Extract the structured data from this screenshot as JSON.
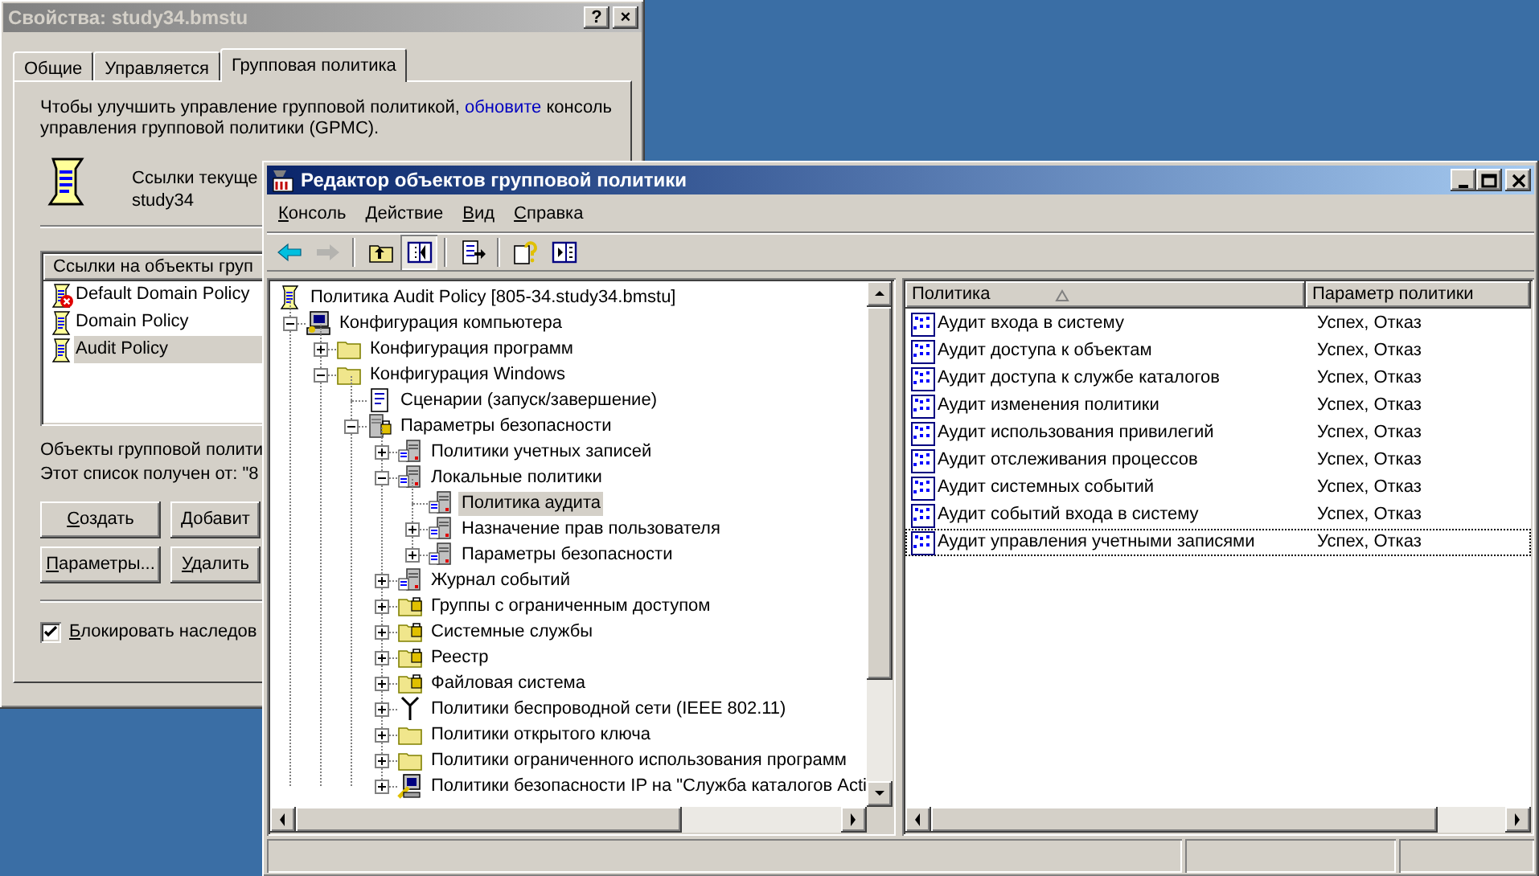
{
  "properties_window": {
    "title": "Свойства: study34.bmstu",
    "title_buttons": [
      "?",
      "×"
    ],
    "tabs": [
      {
        "label": "Общие",
        "selected": false
      },
      {
        "label": "Управляется",
        "selected": false
      },
      {
        "label": "Групповая политика",
        "selected": true
      }
    ],
    "intro": {
      "before": "Чтобы улучшить управление групповой политикой, ",
      "link": "обновите",
      "after": " консоль управления групповой политики (GPMC)."
    },
    "links_label": "Ссылки текуще",
    "domain": "study34",
    "list": {
      "header": "Ссылки на объекты груп",
      "items": [
        {
          "label": "Default Domain Policy",
          "kind": "disabled",
          "selected": false
        },
        {
          "label": "Domain Policy",
          "kind": "enabled",
          "selected": false
        },
        {
          "label": "Audit Policy",
          "kind": "enabled",
          "selected": true
        }
      ]
    },
    "objects_note": "Объекты групповой полити",
    "source_note": "Этот список получен от: \"8",
    "buttons": [
      "Создать",
      "Добавит",
      "Параметры...",
      "Удалить"
    ],
    "block_inheritance": {
      "label": "Блокировать наследов",
      "checked": true
    }
  },
  "editor_window": {
    "title": "Редактор объектов групповой политики",
    "menu": [
      "Консоль",
      "Действие",
      "Вид",
      "Справка"
    ],
    "toolbar": [
      {
        "kind": "back",
        "disabled": false,
        "pressed": false
      },
      {
        "kind": "forward",
        "disabled": true,
        "pressed": false
      },
      {
        "kind": "separator"
      },
      {
        "kind": "up",
        "disabled": false,
        "pressed": false
      },
      {
        "kind": "tree",
        "disabled": false,
        "pressed": true
      },
      {
        "kind": "separator"
      },
      {
        "kind": "export",
        "disabled": false,
        "pressed": false
      },
      {
        "kind": "separator"
      },
      {
        "kind": "help",
        "disabled": false,
        "pressed": false
      },
      {
        "kind": "action-pane",
        "disabled": false,
        "pressed": false
      }
    ],
    "tree": {
      "label": "Политика Audit Policy [805-34.study34.bmstu]",
      "kind": "scroll",
      "selected": false,
      "children": [
        {
          "label": "Конфигурация компьютера",
          "kind": "computer",
          "expanded": true,
          "selected": false,
          "children": [
            {
              "label": "Конфигурация программ",
              "kind": "folder",
              "expanded": false,
              "selected": false
            },
            {
              "label": "Конфигурация Windows",
              "kind": "folder",
              "expanded": true,
              "selected": false,
              "children": [
                {
                  "label": "Сценарии (запуск/завершение)",
                  "kind": "script",
                  "selected": false
                },
                {
                  "label": "Параметры безопасности",
                  "kind": "secure",
                  "expanded": true,
                  "selected": false,
                  "children": [
                    {
                      "label": "Политики учетных записей",
                      "kind": "policy",
                      "expanded": false,
                      "selected": false
                    },
                    {
                      "label": "Локальные политики",
                      "kind": "policy",
                      "expanded": true,
                      "selected": false,
                      "children": [
                        {
                          "label": "Политика аудита",
                          "kind": "policy",
                          "selected": true
                        },
                        {
                          "label": "Назначение прав пользователя",
                          "kind": "policy",
                          "expanded": false,
                          "selected": false
                        },
                        {
                          "label": "Параметры безопасности",
                          "kind": "policy",
                          "expanded": false,
                          "selected": false
                        }
                      ]
                    },
                    {
                      "label": "Журнал событий",
                      "kind": "policy",
                      "expanded": false,
                      "selected": false
                    },
                    {
                      "label": "Группы с ограниченным доступом",
                      "kind": "lock-folder",
                      "expanded": false,
                      "selected": false
                    },
                    {
                      "label": "Системные службы",
                      "kind": "lock-folder",
                      "expanded": false,
                      "selected": false
                    },
                    {
                      "label": "Реестр",
                      "kind": "lock-folder",
                      "expanded": false,
                      "selected": false
                    },
                    {
                      "label": "Файловая система",
                      "kind": "lock-folder",
                      "expanded": false,
                      "selected": false
                    },
                    {
                      "label": "Политики беспроводной сети (IEEE 802.11)",
                      "kind": "antenna",
                      "expanded": false,
                      "selected": false
                    },
                    {
                      "label": "Политики открытого ключа",
                      "kind": "folder",
                      "expanded": false,
                      "selected": false
                    },
                    {
                      "label": "Политики ограниченного использования программ",
                      "kind": "folder",
                      "expanded": false,
                      "selected": false
                    },
                    {
                      "label": "Политики безопасности IP на \"Служба каталогов Acti",
                      "kind": "ip-security",
                      "expanded": false,
                      "selected": false
                    }
                  ]
                }
              ]
            }
          ]
        }
      ]
    },
    "list": {
      "columns": [
        {
          "label": "Политика",
          "sorted": true
        },
        {
          "label": "Параметр политики",
          "sorted": false
        }
      ],
      "rows": [
        {
          "policy": "Аудит входа в систему",
          "setting": "Успех, Отказ",
          "focused": false
        },
        {
          "policy": "Аудит доступа к объектам",
          "setting": "Успех, Отказ",
          "focused": false
        },
        {
          "policy": "Аудит доступа к службе каталогов",
          "setting": "Успех, Отказ",
          "focused": false
        },
        {
          "policy": "Аудит изменения политики",
          "setting": "Успех, Отказ",
          "focused": false
        },
        {
          "policy": "Аудит использования привилегий",
          "setting": "Успех, Отказ",
          "focused": false
        },
        {
          "policy": "Аудит отслеживания процессов",
          "setting": "Успех, Отказ",
          "focused": false
        },
        {
          "policy": "Аудит системных событий",
          "setting": "Успех, Отказ",
          "focused": false
        },
        {
          "policy": "Аудит событий входа в систему",
          "setting": "Успех, Отказ",
          "focused": false
        },
        {
          "policy": "Аудит управления учетными записями",
          "setting": "Успех, Отказ",
          "focused": true
        }
      ]
    }
  }
}
